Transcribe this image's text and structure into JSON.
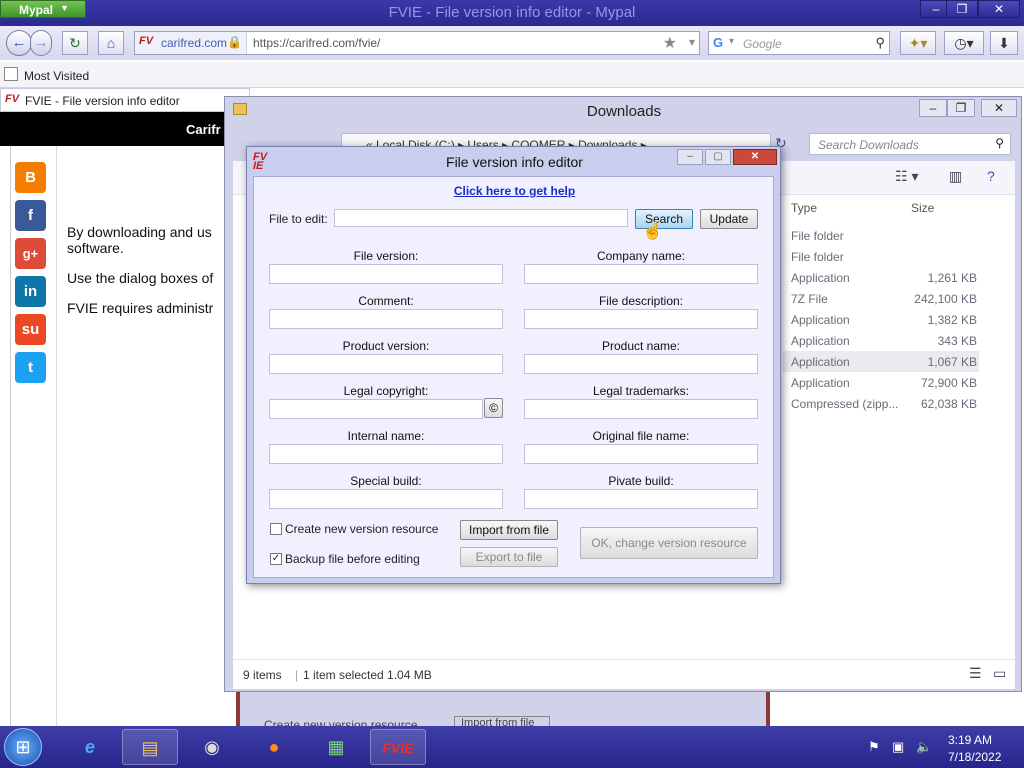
{
  "browser": {
    "app_button": "Mypal",
    "window_title": "FVIE - File version info editor - Mypal",
    "site_name": "carifred.com",
    "url": "https://carifred.com/fvie/",
    "search_placeholder": "Google",
    "bookmark": "Most Visited",
    "tab_title": "FVIE - File version info editor",
    "page_header": "Carifr",
    "page_lines": [
      "By downloading and us",
      "software.",
      "Use the dialog boxes of",
      "FVIE requires administr"
    ]
  },
  "downloads": {
    "title": "Downloads",
    "breadcrumb": "«  Local Disk (C:)  ▸  Users  ▸  COOMER  ▸  Downloads  ▸",
    "search_placeholder": "Search Downloads",
    "columns": {
      "type": "Type",
      "size": "Size"
    },
    "rows": [
      {
        "type": "File folder",
        "size": ""
      },
      {
        "type": "File folder",
        "size": ""
      },
      {
        "type": "Application",
        "size": "1,261 KB"
      },
      {
        "type": "7Z File",
        "size": "242,100 KB"
      },
      {
        "type": "Application",
        "size": "1,382 KB"
      },
      {
        "type": "Application",
        "size": "343 KB"
      },
      {
        "type": "Application",
        "size": "1,067 KB"
      },
      {
        "type": "Application",
        "size": "72,900 KB"
      },
      {
        "type": "Compressed (zipp...",
        "size": "62,038 KB"
      }
    ],
    "status_items": "9 items",
    "status_selected": "1 item selected  1.04 MB"
  },
  "dialog": {
    "title": "File version info editor",
    "help_link": "Click here to get help",
    "file_label": "File to edit:",
    "file_value": "",
    "search_btn": "Search",
    "update_btn": "Update",
    "fields": {
      "file_version": "File version:",
      "company_name": "Company name:",
      "comment": "Comment:",
      "file_description": "File description:",
      "product_version": "Product version:",
      "product_name": "Product name:",
      "legal_copyright": "Legal copyright:",
      "legal_trademarks": "Legal trademarks:",
      "internal_name": "Internal name:",
      "original_file_name": "Original file name:",
      "special_build": "Special build:",
      "private_build": "Pivate build:"
    },
    "copyright_symbol": "©",
    "create_new_label": "Create new version resource",
    "create_new_checked": false,
    "backup_label": "Backup file before editing",
    "backup_checked": true,
    "import_btn": "Import from file",
    "export_btn": "Export to file",
    "ok_btn": "OK, change version resource",
    "ghost_label": "Create new version resource",
    "ghost_button": "Import from file"
  },
  "taskbar": {
    "time": "3:19 AM",
    "date": "7/18/2022"
  }
}
